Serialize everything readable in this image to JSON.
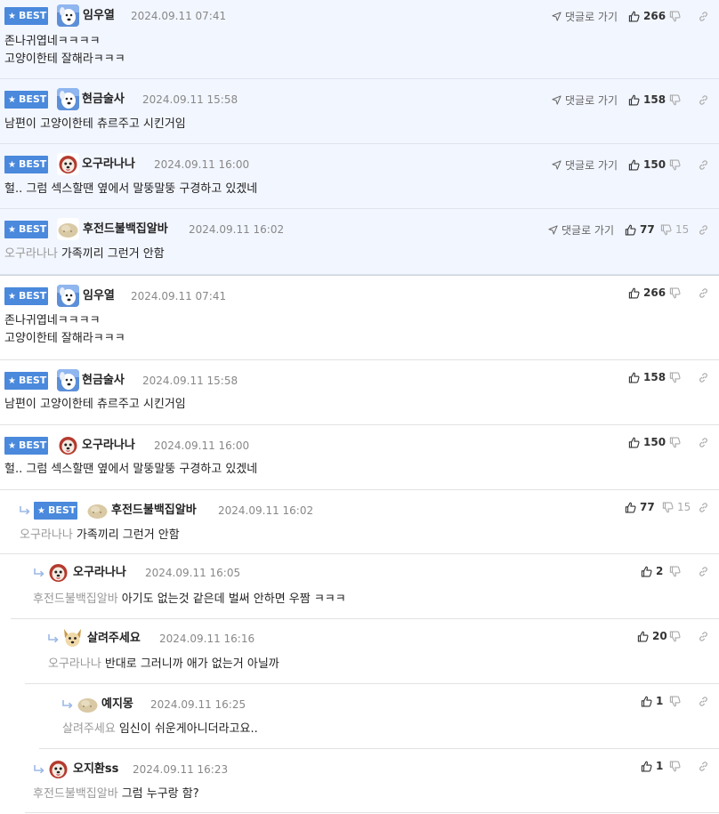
{
  "labels": {
    "best": "BEST",
    "goto": "댓글로 가기"
  },
  "best_comments": [
    {
      "nick": "임우열",
      "date": "2024.09.11 07:41",
      "lines": [
        "존나귀엽네ㅋㅋㅋㅋ",
        "고양이한테 잘해라ㅋㅋㅋ"
      ],
      "likes": "266",
      "dislikes": "",
      "avatar": "dog-icon"
    },
    {
      "nick": "현금술사",
      "date": "2024.09.11 15:58",
      "lines": [
        "남편이 고양이한테 츄르주고 시킨거임"
      ],
      "likes": "158",
      "dislikes": "",
      "avatar": "dog-icon"
    },
    {
      "nick": "오구라나나",
      "date": "2024.09.11 16:00",
      "lines": [
        "헐.. 그럼 섹스할땐 옆에서 말뚱말뚱 구경하고 있겠네"
      ],
      "likes": "150",
      "dislikes": "",
      "avatar": "puppy-icon"
    },
    {
      "nick": "후전드불백집알바",
      "date": "2024.09.11 16:02",
      "mention": "오구라나나",
      "lines": [
        "가족끼리 그런거 안함"
      ],
      "likes": "77",
      "dislikes": "15",
      "avatar": "blob-icon"
    }
  ],
  "comments": [
    {
      "nick": "임우열",
      "date": "2024.09.11 07:41",
      "lines": [
        "존나귀엽네ㅋㅋㅋㅋ",
        "고양이한테 잘해라ㅋㅋㅋ"
      ],
      "likes": "266",
      "dislikes": ""
    },
    {
      "nick": "현금술사",
      "date": "2024.09.11 15:58",
      "lines": [
        "남편이 고양이한테 츄르주고 시킨거임"
      ],
      "likes": "158",
      "dislikes": ""
    },
    {
      "nick": "오구라나나",
      "date": "2024.09.11 16:00",
      "lines": [
        "헐.. 그럼 섹스할땐 옆에서 말뚱말뚱 구경하고 있겠네"
      ],
      "likes": "150",
      "dislikes": ""
    },
    {
      "nick": "후전드불백집알바",
      "date": "2024.09.11 16:02",
      "mention": "오구라나나",
      "lines": [
        "가족끼리 그런거 안함"
      ],
      "likes": "77",
      "dislikes": "15"
    },
    {
      "nick": "오구라나나",
      "date": "2024.09.11 16:05",
      "mention": "후전드불백집알바",
      "lines": [
        "아기도 없는것 같은데 벌써 안하면 우짬 ㅋㅋㅋ"
      ],
      "likes": "2",
      "dislikes": ""
    },
    {
      "nick": "살려주세요",
      "date": "2024.09.11 16:16",
      "mention": "오구라나나",
      "lines": [
        "반대로 그러니까 애가 없는거 아닐까"
      ],
      "likes": "20",
      "dislikes": ""
    },
    {
      "nick": "예지몽",
      "date": "2024.09.11 16:25",
      "mention": "살려주세요",
      "lines": [
        "임신이 쉬운게아니더라고요.."
      ],
      "likes": "1",
      "dislikes": ""
    },
    {
      "nick": "오지환ss",
      "date": "2024.09.11 16:23",
      "mention": "후전드불백집알바",
      "lines": [
        "그럼 누구랑 함?"
      ],
      "likes": "1",
      "dislikes": ""
    }
  ],
  "colors": {
    "best_badge": "#4a89dc",
    "best_bg": "#f2f6ff",
    "mention": "#999999"
  }
}
